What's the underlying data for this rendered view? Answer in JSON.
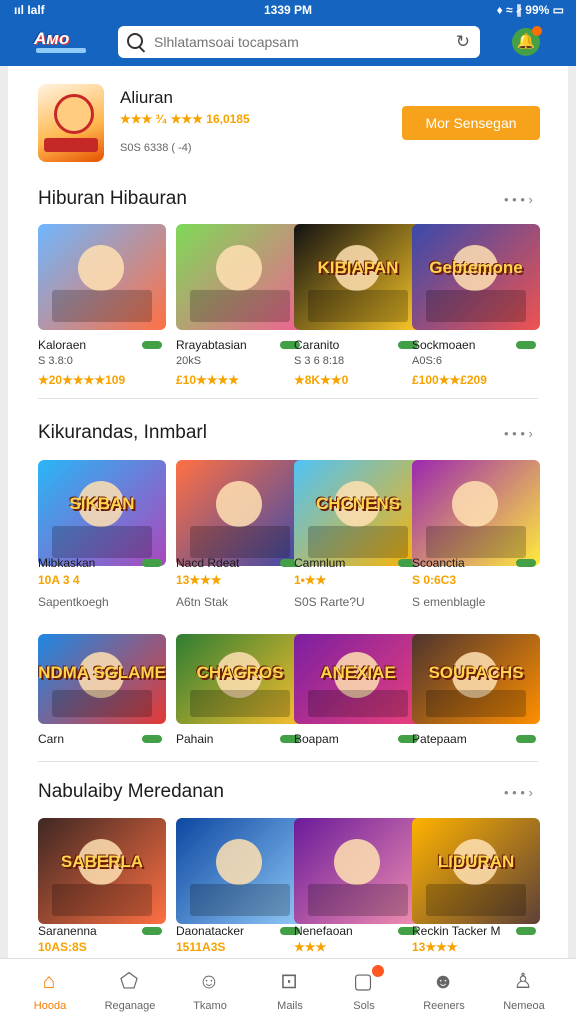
{
  "status_bar": {
    "left": "ııl Ialf",
    "time": "1339 PM",
    "right": "♦ ≈ ∦ 99% ▭"
  },
  "app": {
    "logo_text": "Aᴍo"
  },
  "search": {
    "placeholder": "Slhlatamsoai tocapsam",
    "value": ""
  },
  "featured": {
    "title": "Aliuran",
    "rating_text": "★★★ ³⁄₄ ★★★ 16,0185",
    "meta": "S0S 6338 ( -4)",
    "button_label": "Mor Sensegan"
  },
  "sections": [
    {
      "title": "Hiburan Hibauran",
      "more": "• • • ›",
      "items": [
        {
          "name": "Kaloraen",
          "info": "S 3.8:0",
          "stars": "★20★★★★109",
          "color_a": "#6fb6ff",
          "color_b": "#ff7043",
          "art": ""
        },
        {
          "name": "Rrayabtasian",
          "info": "20kS",
          "stars": "£10★★★★",
          "color_a": "#7ed957",
          "color_b": "#f06292",
          "art": ""
        },
        {
          "name": "Caranito",
          "info": "S 3 6 8:18",
          "stars": "★8K★★0",
          "color_a": "#111111",
          "color_b": "#ffca28",
          "art": "KIBIAPAN"
        },
        {
          "name": "Sockmoaen",
          "info": "A0S:6",
          "stars": "£100★★£209",
          "color_a": "#3949ab",
          "color_b": "#ef5350",
          "art": "Gebtemone"
        }
      ]
    },
    {
      "title": "Kikurandas, Inmbarl",
      "more": "• • • ›",
      "items": [
        {
          "name": "Mibkaskan",
          "info": "",
          "stars": "10A 3 4",
          "extra": "Sapentkoegh",
          "color_a": "#29b6f6",
          "color_b": "#ab47bc",
          "art": "SIKBAN"
        },
        {
          "name": "Nacd Rdeat",
          "info": "",
          "stars": "13★★★",
          "extra": "A6tn Stak",
          "color_a": "#ff7043",
          "color_b": "#3949ab",
          "art": ""
        },
        {
          "name": "Camnlum",
          "info": "",
          "stars": "1•★★",
          "extra": "S0S Rarte?U",
          "color_a": "#4fc3f7",
          "color_b": "#ffb300",
          "art": "CHCNENS"
        },
        {
          "name": "Scoanctia",
          "info": "",
          "stars": "S 0:6C3",
          "extra": "S emenblagle",
          "color_a": "#9c27b0",
          "color_b": "#ffeb3b",
          "art": ""
        },
        {
          "name": "Carn",
          "info": "",
          "stars": "",
          "extra": "",
          "color_a": "#1e88e5",
          "color_b": "#e53935",
          "art": "NDMA SGLAME"
        },
        {
          "name": "Pahain",
          "info": "",
          "stars": "",
          "extra": "",
          "color_a": "#2e7d32",
          "color_b": "#fbc02d",
          "art": "CHAGROS"
        },
        {
          "name": "Boapam",
          "info": "",
          "stars": "",
          "extra": "",
          "color_a": "#7b1fa2",
          "color_b": "#ec407a",
          "art": "ANEXIAE"
        },
        {
          "name": "Patepaam",
          "info": "",
          "stars": "",
          "extra": "",
          "color_a": "#4e342e",
          "color_b": "#ff8f00",
          "art": "SOUPACHS"
        }
      ]
    },
    {
      "title": "Nabulaiby Meredanan",
      "more": "• • • ›",
      "items": [
        {
          "name": "Saranenna",
          "info": "",
          "stars": "10AS:8S",
          "color_a": "#3e2723",
          "color_b": "#ff7043",
          "art": "SABERLA"
        },
        {
          "name": "Daonatacker",
          "info": "",
          "stars": "1511A3S",
          "color_a": "#0d47a1",
          "color_b": "#90caf9",
          "art": ""
        },
        {
          "name": "Nenefaoan",
          "info": "",
          "stars": "★★★",
          "color_a": "#6a1b9a",
          "color_b": "#f48fb1",
          "art": ""
        },
        {
          "name": "Reckin Tacker M",
          "info": "",
          "stars": "13★★★",
          "color_a": "#ffb300",
          "color_b": "#5d4037",
          "art": "LIDURAN"
        }
      ]
    }
  ],
  "bottom_nav": [
    {
      "label": "Hooda",
      "icon": "home-icon",
      "glyph": "⌂",
      "active": true
    },
    {
      "label": "Reganage",
      "icon": "gem-icon",
      "glyph": "⬠",
      "active": false
    },
    {
      "label": "Tkamo",
      "icon": "smile-icon",
      "glyph": "☺",
      "active": false
    },
    {
      "label": "Mails",
      "icon": "mail-icon",
      "glyph": "⊡",
      "active": false
    },
    {
      "label": "Sols",
      "icon": "cart-icon",
      "glyph": "▢",
      "active": false,
      "badge": true
    },
    {
      "label": "Reeners",
      "icon": "face-icon",
      "glyph": "☻",
      "active": false
    },
    {
      "label": "Nemeoa",
      "icon": "profile-icon",
      "glyph": "♙",
      "active": false
    }
  ]
}
